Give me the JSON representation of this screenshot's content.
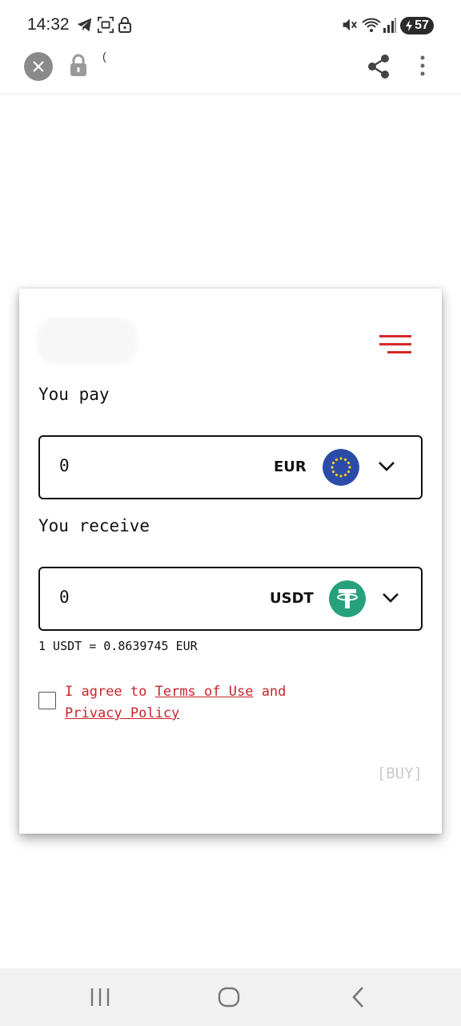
{
  "status_bar": {
    "time": "14:32",
    "battery": "57",
    "icons": [
      "telegram-icon",
      "screenshot-icon",
      "lock-icon",
      "mute-icon",
      "wifi-icon",
      "signal-icon",
      "battery-charging-icon"
    ]
  },
  "toolbar": {
    "url": "(",
    "icons": [
      "close-icon",
      "lock-icon",
      "share-icon",
      "more-vert-icon"
    ]
  },
  "widget": {
    "menu_icon": "hamburger-menu-icon",
    "accent_color": "#d42a2a",
    "pay": {
      "label": "You pay",
      "value": "0",
      "currency": "EUR",
      "icon": "eu-flag-icon"
    },
    "receive": {
      "label": "You receive",
      "value": "0",
      "currency": "USDT",
      "icon": "tether-icon"
    },
    "rate": "1 USDT = 0.8639745 EUR",
    "agree": {
      "prefix": "I agree to",
      "terms": "Terms of Use",
      "and": "and",
      "privacy": "Privacy Policy"
    },
    "buy_label": "[BUY]"
  },
  "nav_bar": {
    "icons": [
      "recent-apps-icon",
      "home-icon",
      "back-icon"
    ]
  }
}
